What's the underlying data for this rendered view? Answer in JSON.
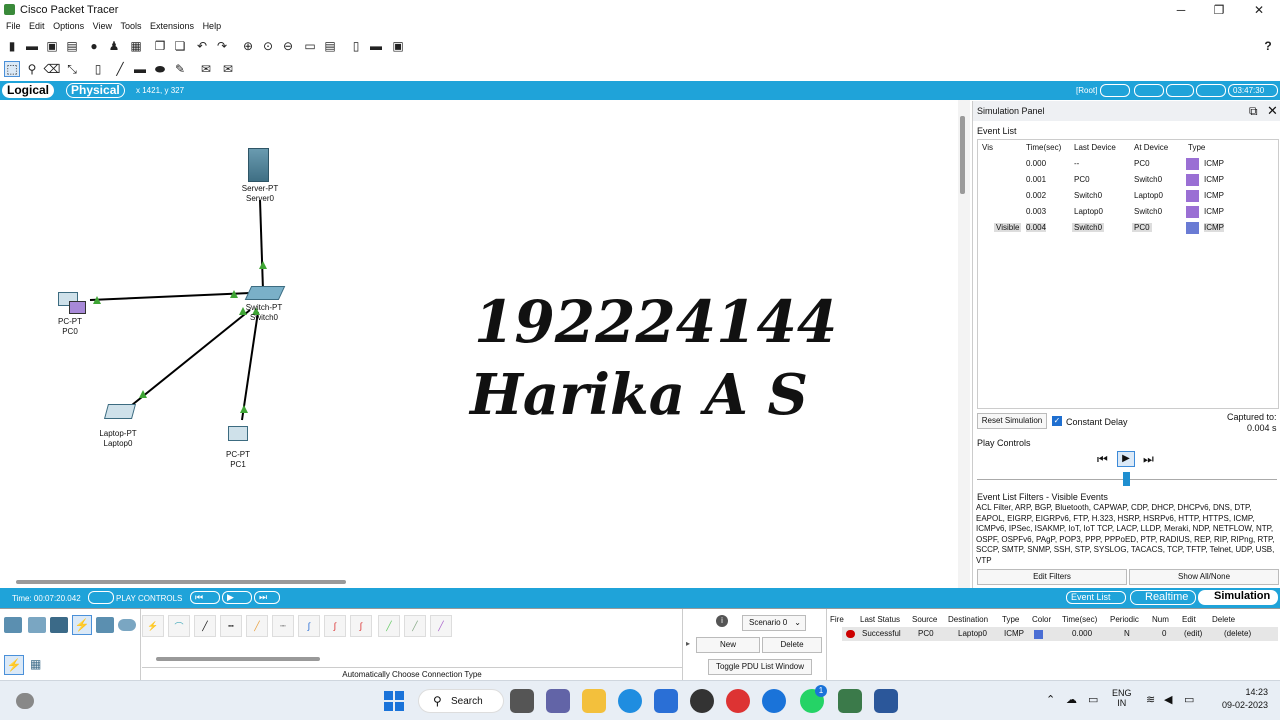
{
  "window": {
    "title": "Cisco Packet Tracer",
    "minimize": "─",
    "maximize": "❐",
    "close": "✕"
  },
  "menu": [
    "File",
    "Edit",
    "Options",
    "View",
    "Tools",
    "Extensions",
    "Help"
  ],
  "toolbar": {
    "help": "?"
  },
  "mode_bar": {
    "logical_tab": "Logical",
    "physical_tab": "Physical",
    "coords": "x 1421, y 327",
    "root": "[Root]",
    "clock": "03:47:30"
  },
  "devices": [
    {
      "type": "Server-PT",
      "name": "Server0"
    },
    {
      "type": "Switch-PT",
      "name": "Switch0"
    },
    {
      "type": "PC-PT",
      "name": "PC0"
    },
    {
      "type": "Laptop-PT",
      "name": "Laptop0"
    },
    {
      "type": "PC-PT",
      "name": "PC1"
    }
  ],
  "overlay": {
    "line1": "192224144",
    "line2": "Harika A S"
  },
  "sim_panel": {
    "title": "Simulation Panel",
    "event_list_label": "Event List",
    "columns": [
      "Vis",
      "Time(sec)",
      "Last Device",
      "At Device",
      "Type"
    ],
    "events": [
      {
        "vis": "",
        "time": "0.000",
        "last": "--",
        "at": "PC0",
        "type": "ICMP"
      },
      {
        "vis": "",
        "time": "0.001",
        "last": "PC0",
        "at": "Switch0",
        "type": "ICMP"
      },
      {
        "vis": "",
        "time": "0.002",
        "last": "Switch0",
        "at": "Laptop0",
        "type": "ICMP"
      },
      {
        "vis": "",
        "time": "0.003",
        "last": "Laptop0",
        "at": "Switch0",
        "type": "ICMP"
      },
      {
        "vis": "Visible",
        "time": "0.004",
        "last": "Switch0",
        "at": "PC0",
        "type": "ICMP"
      }
    ],
    "reset_button": "Reset Simulation",
    "constant_delay": "Constant Delay",
    "captured_label": "Captured to:",
    "captured_value": "0.004 s",
    "play_controls": "Play Controls",
    "filters_title": "Event List Filters - Visible Events",
    "filters_text": "ACL Filter, ARP, BGP, Bluetooth, CAPWAP, CDP, DHCP, DHCPv6, DNS, DTP, EAPOL, EIGRP, EIGRPv6, FTP, H.323, HSRP, HSRPv6, HTTP, HTTPS, ICMP, ICMPv6, IPSec, ISAKMP, IoT, IoT TCP, LACP, LLDP, Meraki, NDP, NETFLOW, NTP, OSPF, OSPFv6, PAgP, POP3, PPP, PPPoED, PTP, RADIUS, REP, RIP, RIPng, RTP, SCCP, SMTP, SNMP, SSH, STP, SYSLOG, TACACS, TCP, TFTP, Telnet, UDP, USB, VTP",
    "edit_filters": "Edit Filters",
    "show_all": "Show All/None"
  },
  "bottom_bar": {
    "time": "Time: 00:07:20.042",
    "play_controls": "PLAY CONTROLS",
    "event_list": "Event List",
    "realtime": "Realtime",
    "simulation": "Simulation"
  },
  "bottom_panel": {
    "connection_hint": "Automatically Choose Connection Type",
    "scenario": "Scenario 0",
    "new_btn": "New",
    "delete_btn": "Delete",
    "toggle_pdu": "Toggle PDU List Window",
    "pdu_columns": [
      "Fire",
      "Last Status",
      "Source",
      "Destination",
      "Type",
      "Color",
      "Time(sec)",
      "Periodic",
      "Num",
      "Edit",
      "Delete"
    ],
    "pdu_row": {
      "status": "Successful",
      "source": "PC0",
      "dest": "Laptop0",
      "type": "ICMP",
      "time": "0.000",
      "periodic": "N",
      "num": "0",
      "edit": "(edit)",
      "delete": "(delete)"
    }
  },
  "taskbar": {
    "search": "Search",
    "lang1": "ENG",
    "lang2": "IN",
    "time": "14:23",
    "date": "09-02-2023",
    "badge": "1"
  },
  "colors": {
    "accent": "#1fa3d9",
    "icmp": "#9a6fd4",
    "link_green": "#3fa535"
  }
}
